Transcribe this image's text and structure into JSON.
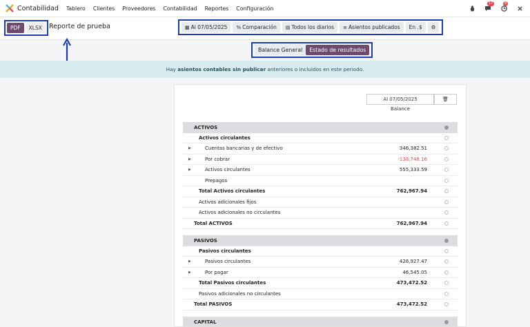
{
  "navbar": {
    "app_title": "Contabilidad",
    "menu": [
      "Tablero",
      "Clientes",
      "Proveedores",
      "Contabilidad",
      "Reportes",
      "Configuración"
    ],
    "chat_badge": "17",
    "activity_badge": "8"
  },
  "toolbar": {
    "pdf_label": "PDF",
    "xlsx_label": "XLSX",
    "report_title": "Reporte de prueba",
    "filters": {
      "date": "Al 07/05/2025",
      "comparison": "Comparación",
      "journals": "Todos los diarios",
      "entries": "Asientos publicados",
      "currency": "En .$"
    }
  },
  "tabs": {
    "balance": "Balance General",
    "income": "Estado de resultados"
  },
  "banner": {
    "pre": "Hay ",
    "bold": "asientos contables sin publicar",
    "post": " anteriores o incluidos en este periodo."
  },
  "report": {
    "column_date": "Al 07/05/2025",
    "column_label": "Balance",
    "rows": [
      {
        "label": "ACTIVOS",
        "value": ""
      },
      {
        "label": "Activos circulantes",
        "value": ""
      },
      {
        "label": "Cuentas bancarias y de efectivo",
        "value": "346,382.51"
      },
      {
        "label": "Por cobrar",
        "value": "-138,748.16"
      },
      {
        "label": "Activos circulantes",
        "value": "555,333.59"
      },
      {
        "label": "Prepagos",
        "value": ""
      },
      {
        "label": "Total Activos circulantes",
        "value": "762,967.94"
      },
      {
        "label": "Activos adicionales fijos",
        "value": ""
      },
      {
        "label": "Activos adicionales no circulantes",
        "value": ""
      },
      {
        "label": "Total ACTIVOS",
        "value": "762,967.94"
      },
      {
        "label": "PASIVOS",
        "value": ""
      },
      {
        "label": "Pasivos circulantes",
        "value": ""
      },
      {
        "label": "Pasivos circulantes",
        "value": "426,927.47"
      },
      {
        "label": "Por pagar",
        "value": "46,545.05"
      },
      {
        "label": "Total Pasivos circulantes",
        "value": "473,472.52"
      },
      {
        "label": "Pasivos adicionales no circulantes",
        "value": ""
      },
      {
        "label": "Total PASIVOS",
        "value": "473,472.52"
      },
      {
        "label": "CAPITAL",
        "value": ""
      }
    ]
  },
  "colors": {
    "annotation": "#1e3bb3",
    "primary": "#6f4a6f",
    "banner_bg": "#d8ecf0",
    "negative": "#d9534f"
  }
}
